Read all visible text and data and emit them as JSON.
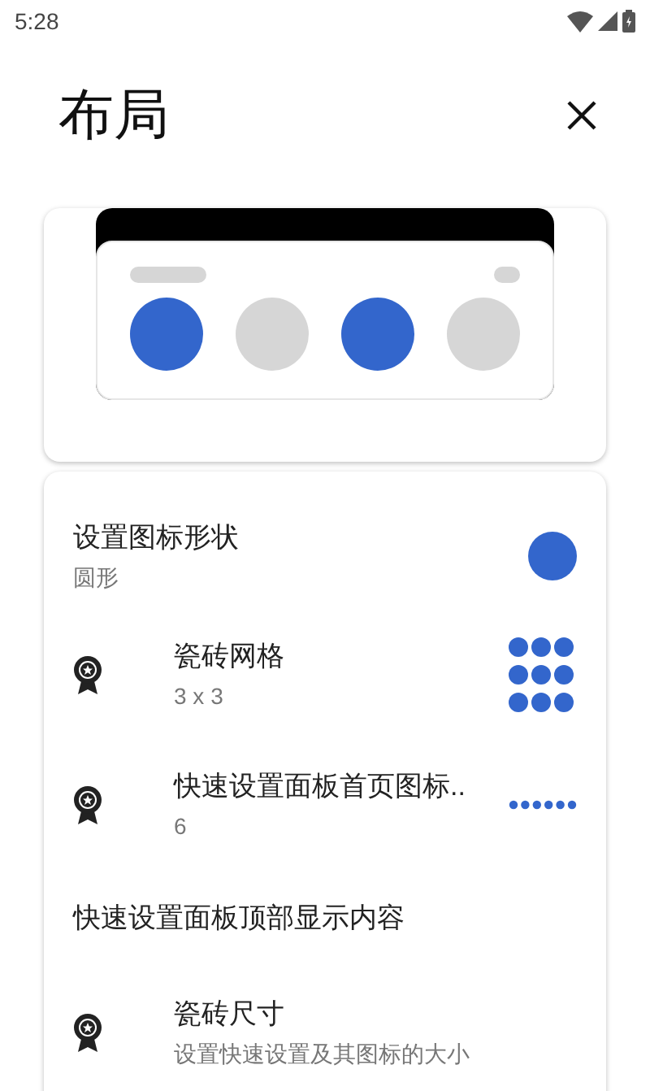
{
  "status_bar": {
    "time": "5:28"
  },
  "header": {
    "title": "布局"
  },
  "preview": {
    "tiles": [
      {
        "on": true
      },
      {
        "on": false
      },
      {
        "on": true
      },
      {
        "on": false
      }
    ]
  },
  "settings": [
    {
      "kind": "shape",
      "title": "设置图标形状",
      "subtitle": "圆形"
    },
    {
      "kind": "grid",
      "title": "瓷砖网格",
      "subtitle": "3 x 3"
    },
    {
      "kind": "dots",
      "title": "快速设置面板首页图标..",
      "subtitle": "6"
    },
    {
      "kind": "header",
      "title": "快速设置面板顶部显示内容"
    },
    {
      "kind": "plain",
      "title": "瓷砖尺寸",
      "subtitle": "设置快速设置及其图标的大小"
    }
  ]
}
